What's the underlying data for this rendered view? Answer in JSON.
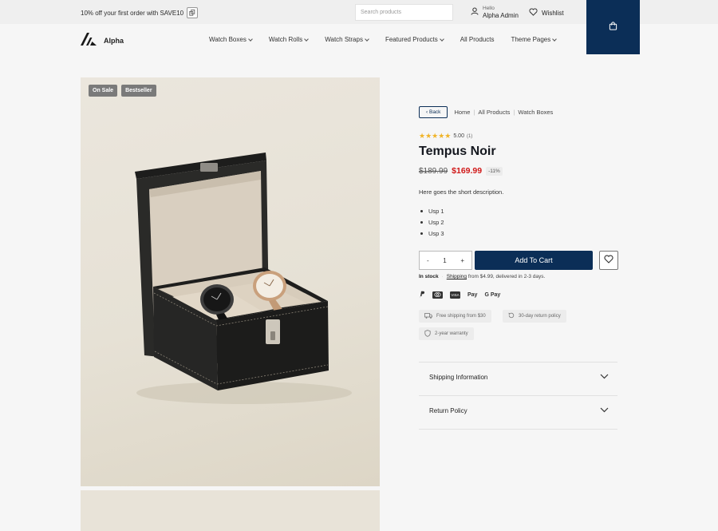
{
  "topbar": {
    "promo_text": "10% off your first order with SAVE10",
    "search_placeholder": "Search products",
    "hello_label": "Hello",
    "user_name": "Alpha Admin",
    "wishlist_label": "Wishlist"
  },
  "brand": {
    "name": "Alpha"
  },
  "nav": {
    "items": [
      {
        "label": "Watch Boxes",
        "has_dropdown": true
      },
      {
        "label": "Watch Rolls",
        "has_dropdown": true
      },
      {
        "label": "Watch Straps",
        "has_dropdown": true
      },
      {
        "label": "Featured Products",
        "has_dropdown": true
      },
      {
        "label": "All Products",
        "has_dropdown": false
      },
      {
        "label": "Theme Pages",
        "has_dropdown": true
      }
    ]
  },
  "gallery": {
    "badges": [
      "On Sale",
      "Bestseller"
    ]
  },
  "breadcrumb": {
    "back_label": "Back",
    "items": [
      "Home",
      "All Products",
      "Watch Boxes"
    ]
  },
  "product": {
    "rating_value": "5.00",
    "rating_count": "(1)",
    "title": "Tempus Noir",
    "old_price": "$189.99",
    "new_price": "$169.99",
    "discount": "-11%",
    "description": "Here goes the short description.",
    "usps": [
      "Usp 1",
      "Usp 2",
      "Usp 3"
    ],
    "quantity": "1",
    "add_to_cart_label": "Add To Cart",
    "stock_status": "In stock",
    "shipping_link": "Shipping",
    "shipping_text": "from $4.99, delivered in 2-3 days."
  },
  "payment_methods": [
    "PayPal",
    "Mastercard",
    "Visa",
    "Apple Pay",
    "Google Pay"
  ],
  "payment_labels": {
    "apple": "Pay",
    "google": "G Pay",
    "visa": "VISA"
  },
  "info_pills": [
    "Free shipping from $30",
    "30-day return policy",
    "2-year warranty"
  ],
  "accordion": [
    {
      "label": "Shipping Information"
    },
    {
      "label": "Return Policy"
    }
  ],
  "colors": {
    "primary": "#0b2e57",
    "sale_price": "#d01818",
    "star": "#f0b429"
  }
}
